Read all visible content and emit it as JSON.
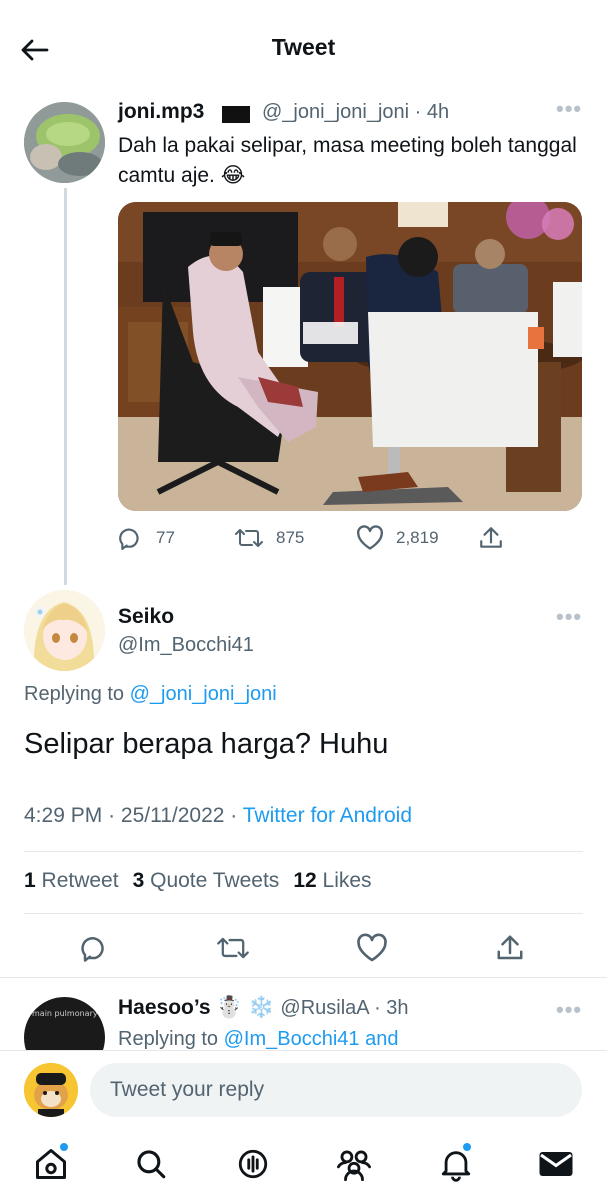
{
  "header": {
    "title": "Tweet"
  },
  "parent_tweet": {
    "name": "joni.mp3",
    "handle": "@_joni_joni_joni",
    "time": "· 4h",
    "text": "Dah la pakai selipar, masa meeting boleh tanggal camtu aje. 😂",
    "replies": "77",
    "retweets": "875",
    "likes": "2,819"
  },
  "main_tweet": {
    "name": "Seiko",
    "handle": "@Im_Bocchi41",
    "replying_prefix": "Replying to",
    "replying_handle": "@_joni_joni_joni",
    "text": "Selipar berapa harga? Huhu",
    "time": "4:29 PM",
    "date": "25/11/2022",
    "dot": "·",
    "source": "Twitter for Android",
    "retweets_count": "1",
    "retweets_label": "Retweet",
    "quotes_count": "3",
    "quotes_label": "Quote Tweets",
    "likes_count": "12",
    "likes_label": "Likes"
  },
  "next_reply": {
    "name": "Haesoo’s ☃️ ❄️",
    "handle": "@RusilaA",
    "time": "· 3h",
    "replying_prefix": "Replying to",
    "replying_handle": "@Im_Bocchi41 and",
    "avatar_text": "main pulmonary artery"
  },
  "compose": {
    "placeholder": "Tweet your reply"
  },
  "colors": {
    "accent": "#1d9bf0",
    "text": "#0f1419",
    "muted": "#536471"
  },
  "icons": {
    "back": "arrow-left-icon",
    "more": "more-icon",
    "reply": "reply-icon",
    "retweet": "retweet-icon",
    "like": "heart-icon",
    "share": "share-icon",
    "nav": [
      "home-icon",
      "search-icon",
      "spaces-icon",
      "communities-icon",
      "notifications-icon",
      "messages-icon"
    ]
  }
}
